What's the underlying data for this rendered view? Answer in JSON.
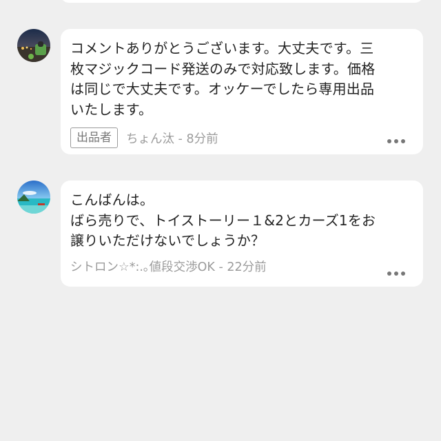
{
  "comments": [
    {
      "avatar_icon": "avatar-night-street-photo",
      "text": "コメントありがとうございます。大丈夫です。三\n枚マジックコード発送のみで対応致します。価格\nは同じで大丈夫です。オッケーでしたら専用出品\nいたします。",
      "badge": "出品者",
      "meta": "ちょん汰 - 8分前",
      "more_icon": "more-options-icon"
    },
    {
      "avatar_icon": "avatar-beach-photo",
      "text": "こんばんは。\nばら売りで、トイストーリー１&2とカーズ1をお\n譲りいただけないでしょうか？",
      "meta": "シトロン☆*:.｡値段交渉OK - 22分前",
      "more_icon": "more-options-icon"
    }
  ]
}
